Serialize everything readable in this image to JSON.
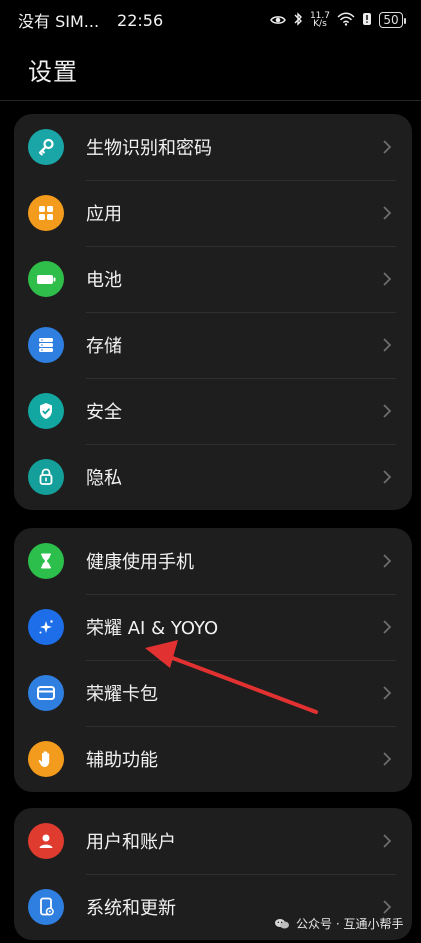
{
  "status_bar": {
    "carrier": "没有 SIM...",
    "time": "22:56",
    "speed_top": "11.7",
    "speed_bottom": "K/s",
    "battery": "50",
    "icons": [
      "eye-icon",
      "bluetooth-icon",
      "wifi-icon",
      "alert-icon",
      "battery-icon"
    ]
  },
  "header": {
    "title": "设置"
  },
  "groups": [
    {
      "items": [
        {
          "label": "生物识别和密码",
          "icon": "key-icon",
          "color": "#1aa6a6"
        },
        {
          "label": "应用",
          "icon": "apps-grid-icon",
          "color": "#f29b1c"
        },
        {
          "label": "电池",
          "icon": "battery-icon",
          "color": "#2fbe4a"
        },
        {
          "label": "存储",
          "icon": "storage-icon",
          "color": "#2f7fe0"
        },
        {
          "label": "安全",
          "icon": "shield-icon",
          "color": "#12a7a0"
        },
        {
          "label": "隐私",
          "icon": "privacy-lock-icon",
          "color": "#149f9a"
        }
      ]
    },
    {
      "items": [
        {
          "label": "健康使用手机",
          "icon": "hourglass-icon",
          "color": "#2cbf4b"
        },
        {
          "label": "荣耀 AI & YOYO",
          "icon": "sparkle-icon",
          "color": "#1d6ee8"
        },
        {
          "label": "荣耀卡包",
          "icon": "card-icon",
          "color": "#2f7fe0"
        },
        {
          "label": "辅助功能",
          "icon": "hand-icon",
          "color": "#f29b1c"
        }
      ]
    },
    {
      "items": [
        {
          "label": "用户和账户",
          "icon": "user-icon",
          "color": "#e03b2f"
        },
        {
          "label": "系统和更新",
          "icon": "system-update-icon",
          "color": "#2f7fe0"
        }
      ]
    }
  ],
  "annotation": {
    "arrow_color": "#e23131"
  },
  "watermark": {
    "text": "公众号 · 互通小帮手"
  }
}
